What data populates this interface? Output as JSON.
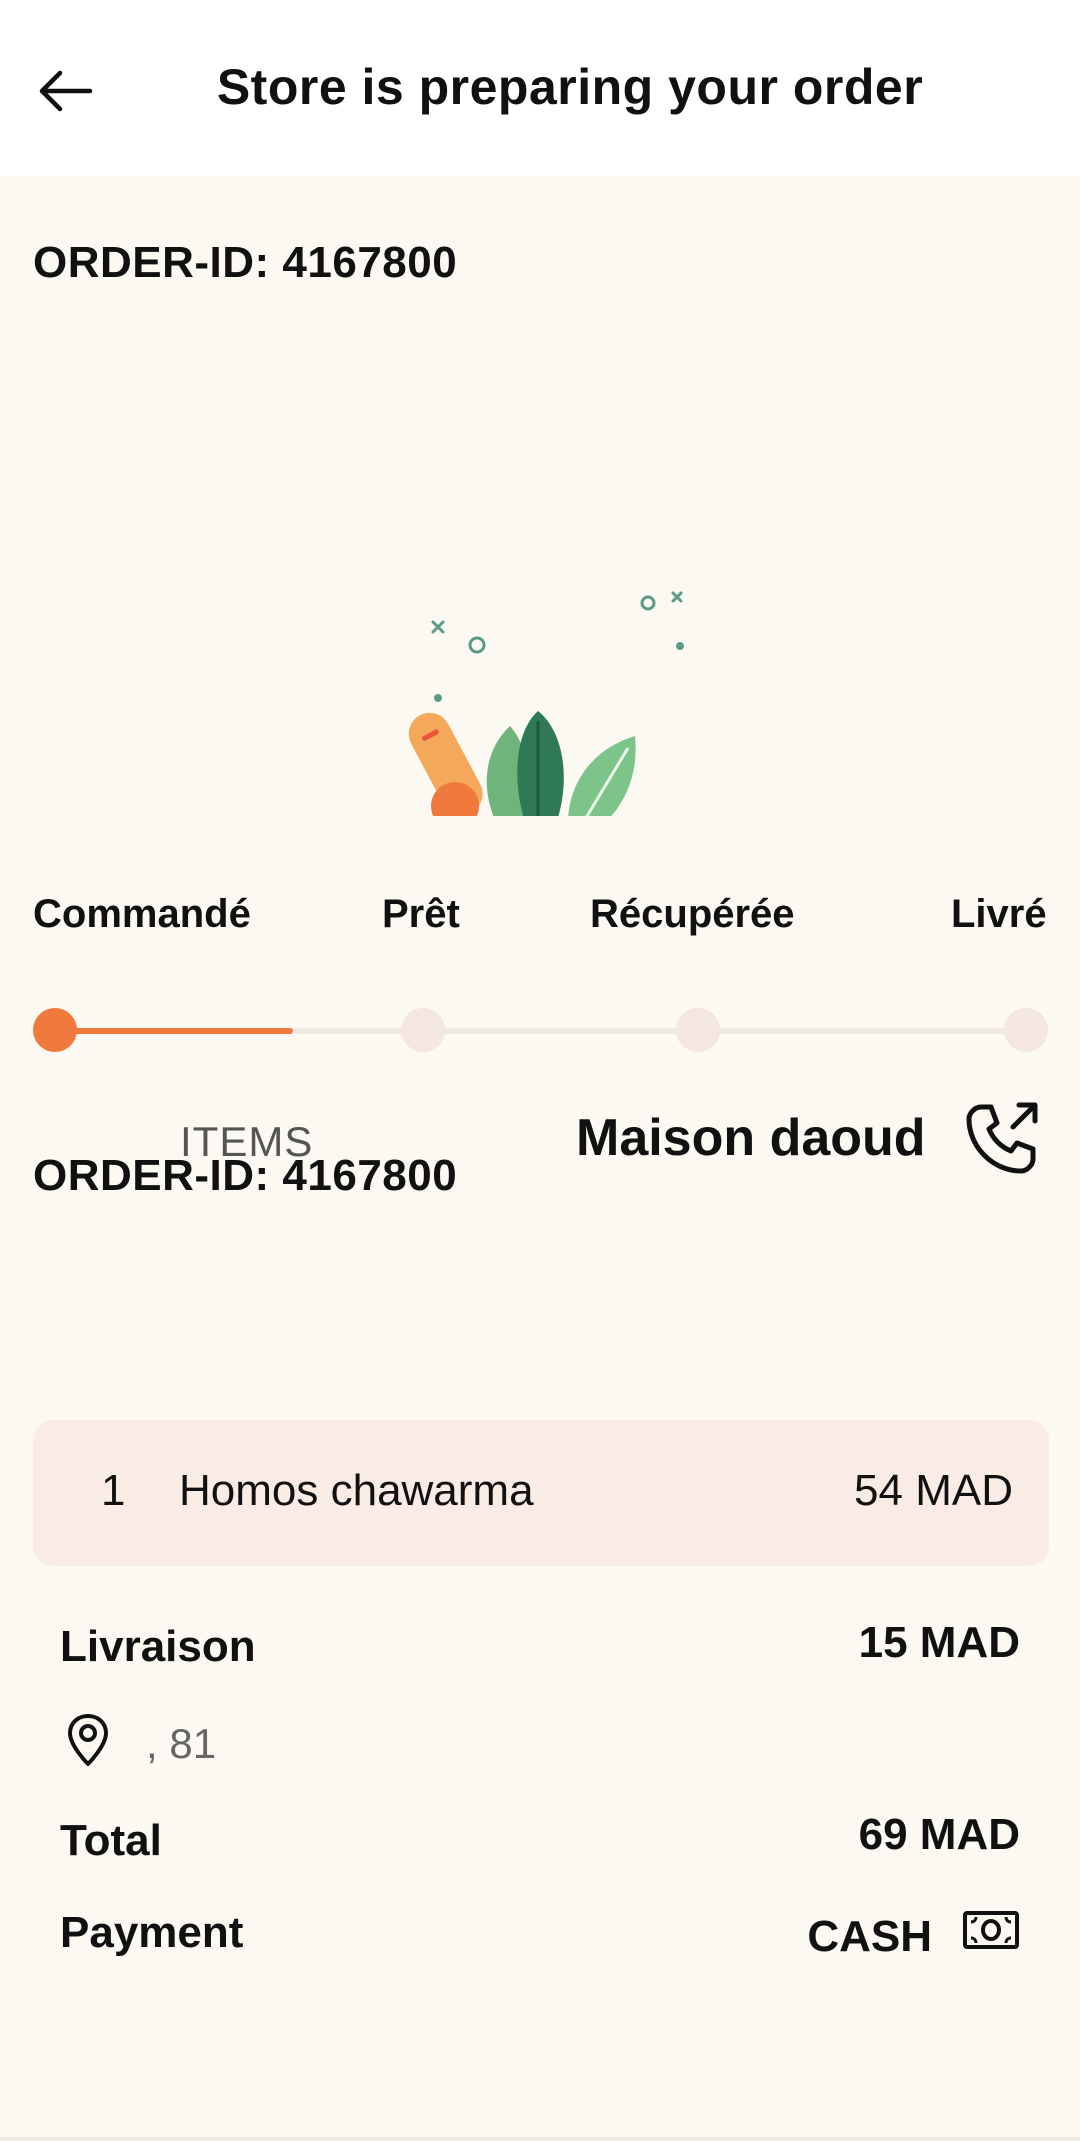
{
  "header": {
    "title": "Store is preparing your order",
    "back_icon": "arrow-left-icon"
  },
  "order": {
    "id_label": "ORDER-ID: 4167800",
    "id_label_2": "ORDER-ID: 4167800"
  },
  "steps": [
    {
      "label": "Commandé",
      "done": true
    },
    {
      "label": "Prêt",
      "done": false
    },
    {
      "label": "Récupérée",
      "done": false
    },
    {
      "label": "Livré",
      "done": false
    }
  ],
  "progress": {
    "completed_fraction": 0.25
  },
  "tabs": {
    "items": "ITEMS"
  },
  "store": {
    "name": "Maison daoud",
    "call_icon": "phone-call-icon"
  },
  "items": [
    {
      "qty": "1",
      "name": "Homos chawarma",
      "price": "54 MAD"
    }
  ],
  "summary": {
    "delivery_label": "Livraison",
    "delivery_value": "15 MAD",
    "address_icon": "location-pin-icon",
    "address_text": ", 81",
    "total_label": "Total",
    "total_value": "69 MAD",
    "payment_label": "Payment",
    "payment_value": "CASH",
    "payment_icon": "banknote-icon"
  },
  "colors": {
    "accent": "#f07a3e",
    "background": "#fcf9f2",
    "card": "#f8ece4"
  }
}
